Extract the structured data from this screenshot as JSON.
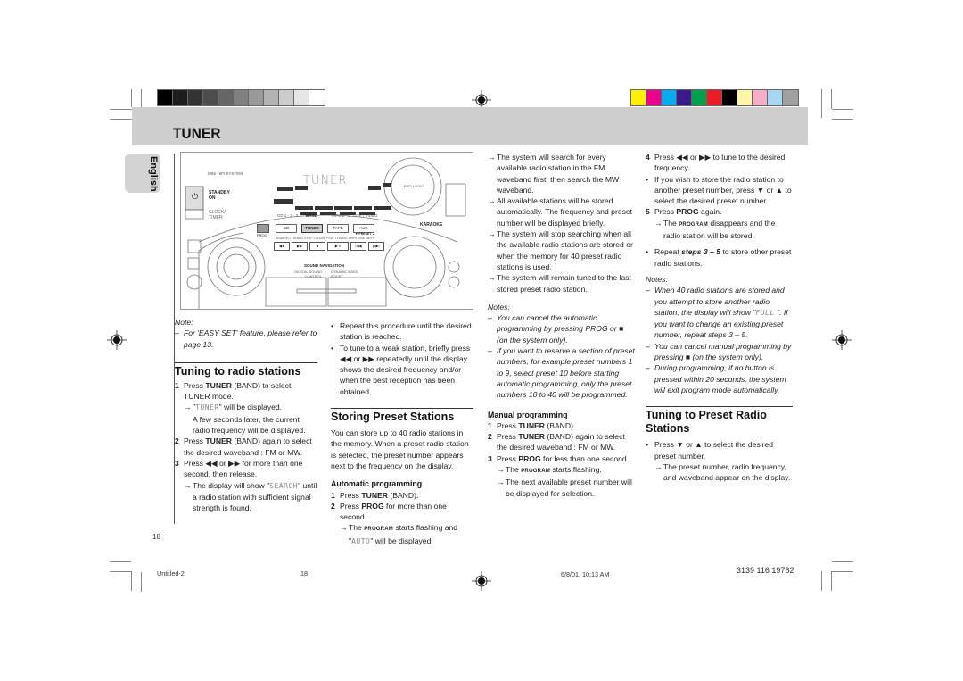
{
  "header": {
    "title": "TUNER"
  },
  "grayscale_bar": [
    "#000000",
    "#1c1c1c",
    "#333333",
    "#4d4d4d",
    "#666666",
    "#808080",
    "#999999",
    "#b3b3b3",
    "#cccccc",
    "#e6e6e6",
    "#ffffff"
  ],
  "color_bar": [
    "#fff200",
    "#ec008c",
    "#00aeef",
    "#3b1a8c",
    "#00a14b",
    "#ed1c24",
    "#000000",
    "#fff7a8",
    "#f6adc6",
    "#a6d8f5",
    "#a0a0a0"
  ],
  "sidebar": {
    "language_tab": "English"
  },
  "device": {
    "label_system": "MINI HIFI SYSTEM",
    "display_text": "TUNER",
    "standby": "STANDBY",
    "on": "ON",
    "clock_timer": "CLOCK/ TIMER",
    "source_labels": [
      "CD 1 - 2 - 3",
      "BAND",
      "TAPE 1 - 2",
      "CDR / VIDEO"
    ],
    "source_buttons": [
      "CD",
      "TUNER",
      "TAPE",
      "AUX"
    ],
    "prog": "PROG",
    "karaoke": "KARAOKE",
    "pro_logic": "PRO LOGIC",
    "transport_labels": "SEARCH • TUNING   STOP • CLEAR  PLAY • PAUSE   PREV  SIDE  NEXT",
    "preset": "▼ PRESET ▲",
    "transport_buttons": [
      "◀◀",
      "▶▶",
      "■",
      "▶ II",
      "I◀◀",
      "▶▶I"
    ],
    "sound_navigation": "SOUND NAVIGATION",
    "dsc": "DIGITAL SOUND CONTROL",
    "dbb": "DYNAMIC BASS BOOST"
  },
  "col1": {
    "note_label": "Note:",
    "note_text": "For 'EASY SET' feature, please refer to page 13.",
    "section_title": "Tuning to radio stations",
    "steps": [
      {
        "n": "1",
        "pre": "Press ",
        "bold": "TUNER",
        "post": " (BAND) to select TUNER mode."
      },
      {
        "n": "2",
        "pre": "Press ",
        "bold": "TUNER",
        "post": " (BAND) again to select the desired waveband : FM or MW."
      },
      {
        "n": "3",
        "pre": "Press ◀◀ or ▶▶ for more than one second, then release.",
        "bold": "",
        "post": ""
      }
    ],
    "step1_arrow_pre": "\"",
    "step1_lcd": "TUNER",
    "step1_arrow_post": "\" will be displayed.",
    "step1_cont": "A few seconds later, the current radio frequency will be displayed.",
    "step3_arrow_pre": "The display will show \"",
    "step3_lcd": "SEARCH",
    "step3_arrow_post": "\" until a radio station with sufficient signal strength is found."
  },
  "col2": {
    "bullets": [
      "Repeat this procedure until the desired station is reached.",
      "To tune to a weak station, briefly press ◀◀ or ▶▶ repeatedly until the display shows the desired frequency and/or when the best reception has been obtained."
    ],
    "section_title": "Storing Preset Stations",
    "intro": "You can store up to 40 radio stations in the memory. When a preset radio station is selected, the preset number appears next to the frequency on the display.",
    "auto_title": "Automatic programming",
    "auto_step1_pre": "Press ",
    "auto_step1_bold": "TUNER",
    "auto_step1_post": " (BAND).",
    "auto_step2_pre": "Press ",
    "auto_step2_bold": "PROG",
    "auto_step2_post": " for more than one second.",
    "auto_arrow_pre": "The ",
    "auto_arrow_prog": "PROGRAM",
    "auto_arrow_mid": " starts flashing and \"",
    "auto_arrow_lcd": "AUTO",
    "auto_arrow_post": "\" will be displayed."
  },
  "col3": {
    "arrows": [
      "The system will search for every available radio station in the FM waveband first, then search the MW waveband.",
      "All available stations will be stored automatically. The frequency and preset number will be displayed briefly.",
      "The system  will stop searching when all the available radio stations are stored or when the memory for 40 preset radio stations is used.",
      "The system will remain tuned to the last stored preset radio station."
    ],
    "notes_label": "Notes:",
    "notes": [
      "You can cancel the automatic programming by pressing PROG or ■ (on the system only).",
      "If you want to reserve a section of preset numbers, for example preset numbers 1 to 9, select preset 10 before starting automatic programming, only the preset numbers 10 to 40 will be programmed."
    ],
    "manual_title": "Manual programming",
    "manual_step1_pre": "Press ",
    "manual_step1_bold": "TUNER",
    "manual_step1_post": " (BAND).",
    "manual_step2_pre": "Press ",
    "manual_step2_bold": "TUNER",
    "manual_step2_post": " (BAND) again to select the desired waveband : FM or MW.",
    "manual_step3_pre": "Press ",
    "manual_step3_bold": "PROG",
    "manual_step3_post": " for less than one second.",
    "manual_arrow1_pre": "The ",
    "manual_arrow1_prog": "PROGRAM",
    "manual_arrow1_post": " starts flashing.",
    "manual_arrow2": "The next available preset number will be displayed for selection."
  },
  "col4": {
    "step4": "Press ◀◀ or ▶▶ to tune to the desired frequency.",
    "bullet1": "If you wish to store the radio station to another preset number, press ▼ or ▲ to select the desired preset number.",
    "step5_pre": "Press ",
    "step5_bold": "PROG",
    "step5_post": " again.",
    "step5_arrow_pre": "The ",
    "step5_arrow_prog": "PROGRAM",
    "step5_arrow_post": " disappears and the radio station will be stored.",
    "repeat_pre": "Repeat ",
    "repeat_bold": "steps 3 – 5",
    "repeat_post": " to store other preset radio stations.",
    "notes_label": "Notes:",
    "note1_pre": "When 40 radio stations are stored and you attempt to store another radio station, the display will show \"",
    "note1_lcd": "FULL",
    "note1_post": " \". If you want to change an existing preset number, repeat steps 3 – 5.",
    "note2": "You can cancel manual programming by pressing  ■  (on the system only).",
    "note3": "During programming,  if no button is pressed within 20 seconds, the system will exit program mode automatically.",
    "section_title": "Tuning to Preset Radio Stations",
    "bullet2": "Press ▼ or ▲ to select the desired preset number.",
    "arrow2": "The preset number, radio frequency, and waveband appear on the display."
  },
  "page_number": "18",
  "footer": {
    "file": "Untitled-2",
    "page": "18",
    "date": "6/8/01, 10:13 AM",
    "code": "3139 116 19782"
  }
}
